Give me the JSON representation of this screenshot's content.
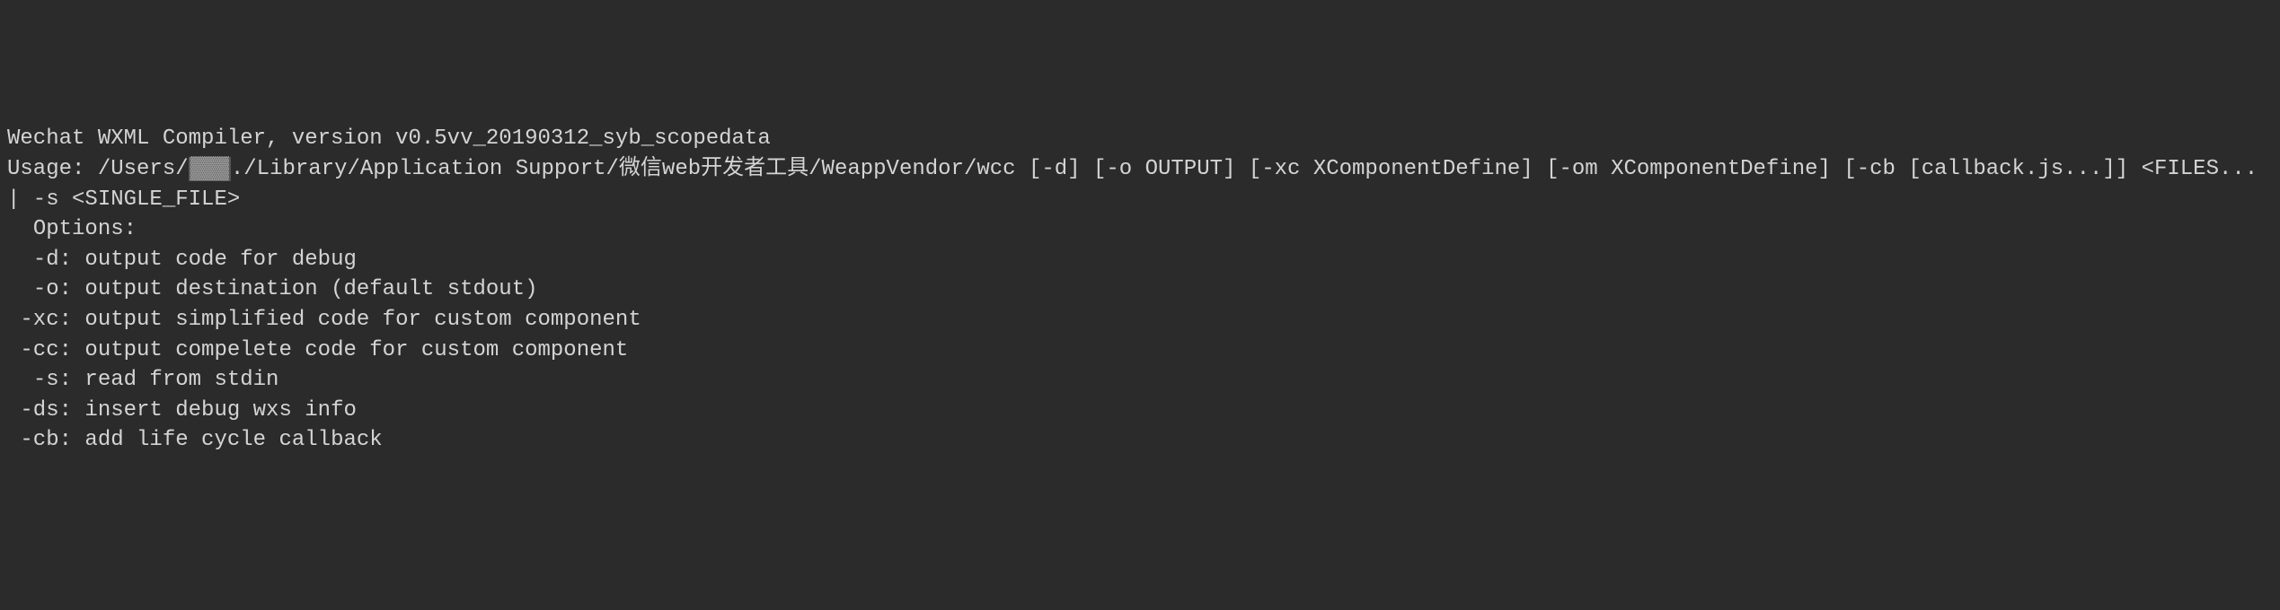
{
  "terminal": {
    "line1": "Wechat WXML Compiler, version v0.5vv_20190312_syb_scopedata",
    "line2_pre": "Usage: /Users/",
    "line2_redacted": "▓▓▓",
    "line2_post": "./Library/Application Support/微信web开发者工具/WeappVendor/wcc [-d] [-o OUTPUT] [-xc XComponentDefine] [-om XComponentDefine] [-cb [callback.js...]] <FILES... | -s <SINGLE_FILE>",
    "line3": "  Options:",
    "line4": "  -d: output code for debug",
    "line5": "  -o: output destination (default stdout)",
    "line6": " -xc: output simplified code for custom component",
    "line7": " -cc: output compelete code for custom component",
    "line8": "  -s: read from stdin",
    "line9": " -ds: insert debug wxs info",
    "line10": " -cb: add life cycle callback"
  }
}
